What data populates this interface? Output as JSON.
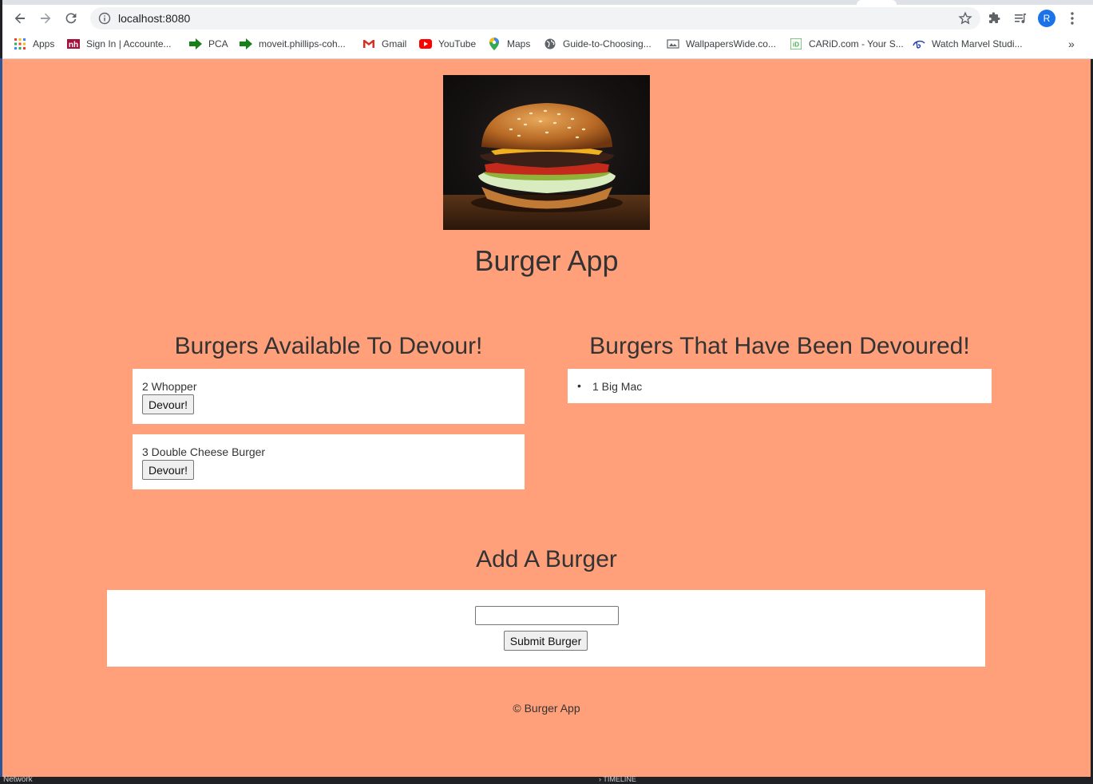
{
  "browser": {
    "url": "localhost:8080",
    "profile_initial": "R",
    "bookmarks": [
      {
        "label": "Apps",
        "icon": "apps-grid-icon"
      },
      {
        "label": "Sign In | Accounte...",
        "icon": "nh-favicon"
      },
      {
        "label": "PCA",
        "icon": "green-arrow-icon"
      },
      {
        "label": "moveit.phillips-coh...",
        "icon": "green-arrow-icon"
      },
      {
        "label": "Gmail",
        "icon": "gmail-icon"
      },
      {
        "label": "YouTube",
        "icon": "youtube-icon"
      },
      {
        "label": "Maps",
        "icon": "maps-pin-icon"
      },
      {
        "label": "Guide-to-Choosing...",
        "icon": "globe-icon"
      },
      {
        "label": "WallpapersWide.co...",
        "icon": "wallpaperswide-icon"
      },
      {
        "label": "CARiD.com - Your S...",
        "icon": "carid-icon"
      },
      {
        "label": "Watch Marvel Studi...",
        "icon": "disney-icon"
      }
    ],
    "more_bookmarks": "»"
  },
  "page": {
    "background": "#ffa07a",
    "app_title": "Burger App",
    "available": {
      "heading": "Burgers Available To Devour!",
      "items": [
        {
          "label": "2 Whopper",
          "button": "Devour!"
        },
        {
          "label": "3 Double Cheese Burger",
          "button": "Devour!"
        }
      ]
    },
    "devoured": {
      "heading": "Burgers That Have Been Devoured!",
      "bullet": "•",
      "items": [
        {
          "label": "1 Big Mac"
        }
      ]
    },
    "add": {
      "heading": "Add A Burger",
      "input_value": "",
      "submit_label": "Submit Burger"
    },
    "footer": "© Burger App"
  },
  "devtools": {
    "left_label": "Network",
    "right_label": "› TIMELINE"
  }
}
